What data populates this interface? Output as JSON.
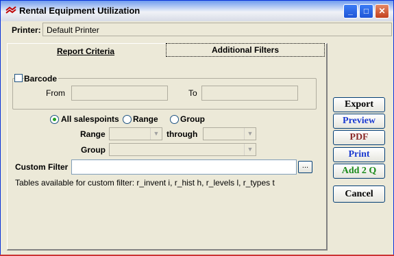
{
  "window": {
    "title": "Rental Equipment Utilization"
  },
  "printer": {
    "label": "Printer:",
    "value": "Default Printer"
  },
  "tabs": [
    {
      "label": "Report Criteria"
    },
    {
      "label": "Additional Filters"
    }
  ],
  "barcode": {
    "label": "Barcode",
    "checked": false,
    "from_label": "From",
    "to_label": "To",
    "from_value": "",
    "to_value": ""
  },
  "salespoints": {
    "options": [
      {
        "label": "All salespoints",
        "selected": true
      },
      {
        "label": "Range",
        "selected": false
      },
      {
        "label": "Group",
        "selected": false
      }
    ],
    "range_label": "Range",
    "through_label": "through",
    "group_label": "Group"
  },
  "custom_filter": {
    "label": "Custom Filter",
    "value": "",
    "button": "...",
    "tables_info": "Tables available for custom filter: r_invent i, r_hist h, r_levels l, r_types t"
  },
  "actions": [
    {
      "label": "Export",
      "color": "#000000"
    },
    {
      "label": "Preview",
      "color": "#1a3ad0"
    },
    {
      "label": "PDF",
      "color": "#8b2a2a"
    },
    {
      "label": "Print",
      "color": "#1a3ad0"
    },
    {
      "label": "Add 2 Q",
      "color": "#1a8a1a"
    },
    {
      "label": "Cancel",
      "color": "#000000"
    }
  ]
}
